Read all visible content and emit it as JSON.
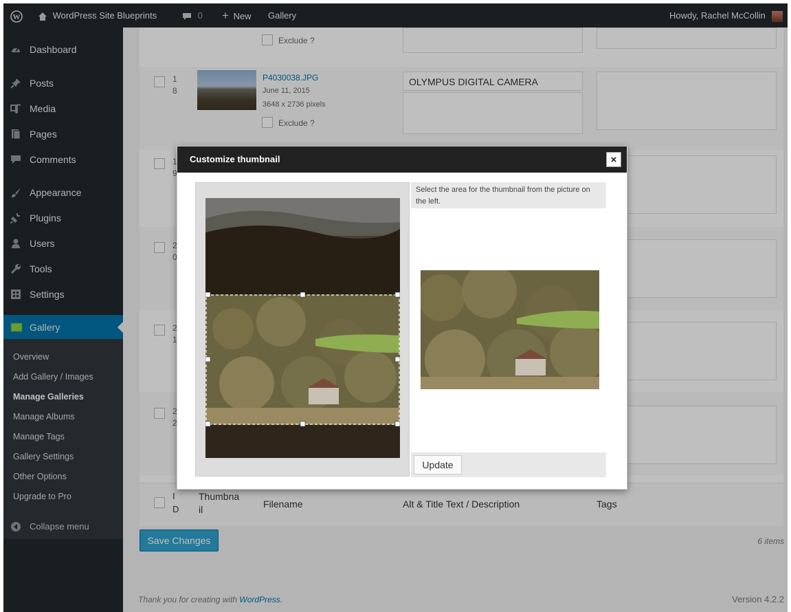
{
  "admin_bar": {
    "site_name": "WordPress Site Blueprints",
    "comments_count": "0",
    "new_label": "New",
    "gallery_label": "Gallery",
    "howdy": "Howdy, Rachel McCollin"
  },
  "sidebar": {
    "items": [
      {
        "label": "Dashboard",
        "icon": "dashboard-icon"
      },
      {
        "label": "Posts",
        "icon": "pin-icon"
      },
      {
        "label": "Media",
        "icon": "media-icon"
      },
      {
        "label": "Pages",
        "icon": "pages-icon"
      },
      {
        "label": "Comments",
        "icon": "comment-icon"
      },
      {
        "label": "Appearance",
        "icon": "brush-icon"
      },
      {
        "label": "Plugins",
        "icon": "plug-icon"
      },
      {
        "label": "Users",
        "icon": "user-icon"
      },
      {
        "label": "Tools",
        "icon": "wrench-icon"
      },
      {
        "label": "Settings",
        "icon": "settings-icon"
      },
      {
        "label": "Gallery",
        "icon": "gallery-icon"
      }
    ],
    "submenu": [
      "Overview",
      "Add Gallery / Images",
      "Manage Galleries",
      "Manage Albums",
      "Manage Tags",
      "Gallery Settings",
      "Other Options",
      "Upgrade to Pro"
    ],
    "collapse": "Collapse menu"
  },
  "table": {
    "exclude_label": "Exclude ?",
    "row18": {
      "id_top": "1",
      "id_bottom": "8",
      "filename": "P4030038.JPG",
      "date": "June 11, 2015",
      "dims": "3648 x 2736 pixels",
      "alt": "OLYMPUS DIGITAL CAMERA"
    },
    "partial_ids": [
      {
        "top": "1",
        "bottom": "9"
      },
      {
        "top": "2",
        "bottom": "0"
      },
      {
        "top": "2",
        "bottom": "1"
      },
      {
        "top": "2",
        "bottom": "2"
      }
    ],
    "footer": {
      "id_top": "I",
      "id_bottom": "D",
      "thumb_top": "Thumbna",
      "thumb_bottom": "il",
      "filename": "Filename",
      "alt": "Alt & Title Text / Description",
      "tags": "Tags"
    }
  },
  "save_button": "Save Changes",
  "items_count": "6 items",
  "footer": {
    "thanks_prefix": "Thank you for creating with ",
    "thanks_link": "WordPress",
    "thanks_suffix": ".",
    "version": "Version 4.2.2"
  },
  "dialog": {
    "title": "Customize thumbnail",
    "close": "×",
    "instructions": "Select the area for the thumbnail from the picture on the left.",
    "update_button": "Update"
  },
  "colors": {
    "admin_bar": "#23282d",
    "sidebar_active": "#0073aa",
    "button": "#2ea2cc",
    "link": "#0073aa"
  }
}
